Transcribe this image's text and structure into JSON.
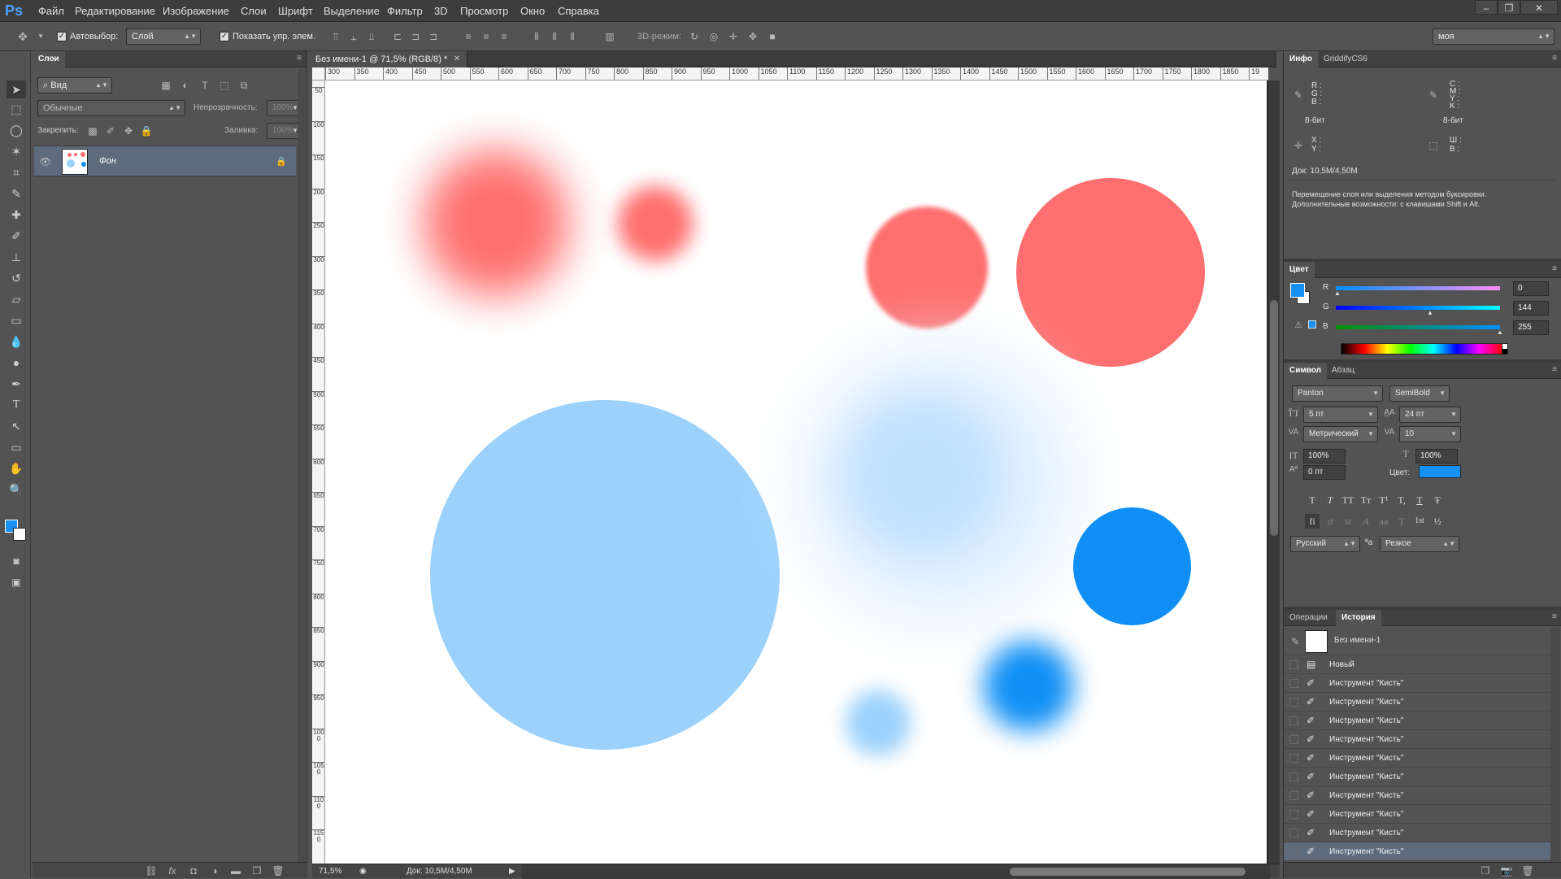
{
  "app": {
    "logo": "Ps"
  },
  "menu": [
    "Файл",
    "Редактирование",
    "Изображение",
    "Слои",
    "Шрифт",
    "Выделение",
    "Фильтр",
    "3D",
    "Просмотр",
    "Окно",
    "Справка"
  ],
  "window_controls": {
    "minimize": "–",
    "restore": "❐",
    "close": "✕"
  },
  "options": {
    "autoselect_label": "Автовыбор:",
    "autoselect_value": "Слой",
    "show_controls_label": "Показать упр. элем.",
    "mode3d_label": "3D-режим:",
    "workspace_value": "моя"
  },
  "layers_panel": {
    "tab": "Слои",
    "filter_value": "Вид",
    "blend_mode": "Обычные",
    "opacity_label": "Непрозрачность:",
    "opacity_value": "100%",
    "lock_label": "Закрепить:",
    "fill_label": "Заливка:",
    "fill_value": "100%",
    "layer_name": "Фон"
  },
  "document": {
    "tab_title": "Без имени-1 @ 71,5% (RGB/8) *",
    "zoom": "71,5%",
    "doc_size": "Док: 10,5M/4,50M",
    "ruler_h": [
      "300",
      "350",
      "400",
      "450",
      "500",
      "550",
      "600",
      "650",
      "700",
      "750",
      "800",
      "850",
      "900",
      "950",
      "1000",
      "1050",
      "1100",
      "1150",
      "1200",
      "1250",
      "1300",
      "1350",
      "1400",
      "1450",
      "1500",
      "1550",
      "1600",
      "1650",
      "1700",
      "1750",
      "1800",
      "1850",
      "19"
    ],
    "ruler_v": [
      "50",
      "100",
      "150",
      "200",
      "250",
      "300",
      "350",
      "400",
      "450",
      "500",
      "550",
      "600",
      "650",
      "700",
      "750",
      "800",
      "850",
      "900",
      "950",
      "1000",
      "1050",
      "1100",
      "1150",
      "12"
    ]
  },
  "canvas_colors": {
    "red": "#ff6f6f",
    "light_blue": "#9bd1fb",
    "blue": "#0f8ff5"
  },
  "info_panel": {
    "tabs": [
      "Инфо",
      "GriddifyCS6"
    ],
    "rgb_labels": [
      "R :",
      "G :",
      "B :"
    ],
    "cmyk_labels": [
      "C :",
      "M :",
      "Y :",
      "K :"
    ],
    "bits_left": "8-бит",
    "bits_right": "8-бит",
    "xy_labels": [
      "X :",
      "Y :"
    ],
    "wh_labels": [
      "Ш :",
      "В :"
    ],
    "doc_size": "Док: 10,5M/4,50M",
    "hint": "Перемещение слоя или выделения методом буксировки. Дополнительные возможности: с клавишами Shift и Alt."
  },
  "color_panel": {
    "tab": "Цвет",
    "r_label": "R",
    "g_label": "G",
    "b_label": "B",
    "r": 0,
    "g": 144,
    "b": 255,
    "fg_color": "#0090ff"
  },
  "character_panel": {
    "tabs": [
      "Символ",
      "Абзац"
    ],
    "font_family": "Panton",
    "font_style": "SemiBold",
    "size": "5 пт",
    "leading": "24 пт",
    "kerning": "Метрический",
    "tracking": "10",
    "vscale": "100%",
    "hscale": "100%",
    "baseline": "0 пт",
    "color_label": "Цвет:",
    "color": "#1791f5",
    "style_buttons": [
      "T",
      "T",
      "TT",
      "Tт",
      "T¹",
      "T,",
      "T",
      "Ŧ"
    ],
    "ot_buttons": [
      "fi",
      "ơ",
      "st",
      "A",
      "aa",
      "T",
      "1st",
      "½"
    ],
    "language": "Русский",
    "aa_icon": "ªa",
    "antialias": "Резкое"
  },
  "history_panel": {
    "tabs": [
      "Операции",
      "История"
    ],
    "snapshot": "Без имени-1",
    "items": [
      "Новый",
      "Инструмент \"Кисть\"",
      "Инструмент \"Кисть\"",
      "Инструмент \"Кисть\"",
      "Инструмент \"Кисть\"",
      "Инструмент \"Кисть\"",
      "Инструмент \"Кисть\"",
      "Инструмент \"Кисть\"",
      "Инструмент \"Кисть\"",
      "Инструмент \"Кисть\"",
      "Инструмент \"Кисть\""
    ]
  }
}
